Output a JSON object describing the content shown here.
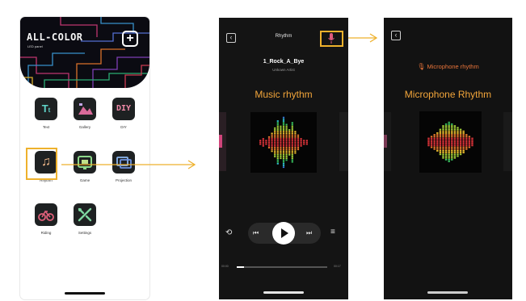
{
  "app": {
    "logo": "ALL-COLOR",
    "subtitle": "LED panel",
    "add_icon": "plus-icon",
    "tiles": [
      {
        "label": "Text",
        "icon": "text-icon"
      },
      {
        "label": "Gallery",
        "icon": "gallery-icon"
      },
      {
        "label": "DIY",
        "icon": "diy-icon"
      },
      {
        "label": "Rhythm",
        "icon": "music-note-icon"
      },
      {
        "label": "Game",
        "icon": "game-icon"
      },
      {
        "label": "Projection",
        "icon": "projection-icon"
      },
      {
        "label": "Riding",
        "icon": "bicycle-icon"
      },
      {
        "label": "Settings",
        "icon": "settings-icon"
      }
    ]
  },
  "music_screen": {
    "title": "Rhythm",
    "song_title": "1_Rock_A_Bye",
    "artist": "Unkown Artist",
    "mode_label": "Music rhythm",
    "time_elapsed": "00:00",
    "time_total": "00:17",
    "progress": 0.08,
    "accent": "#f2a53a",
    "highlight": "#eeb12c"
  },
  "mic_screen": {
    "header_label": "Microphone rhythm",
    "mode_label": "Microphone Rhythm"
  }
}
